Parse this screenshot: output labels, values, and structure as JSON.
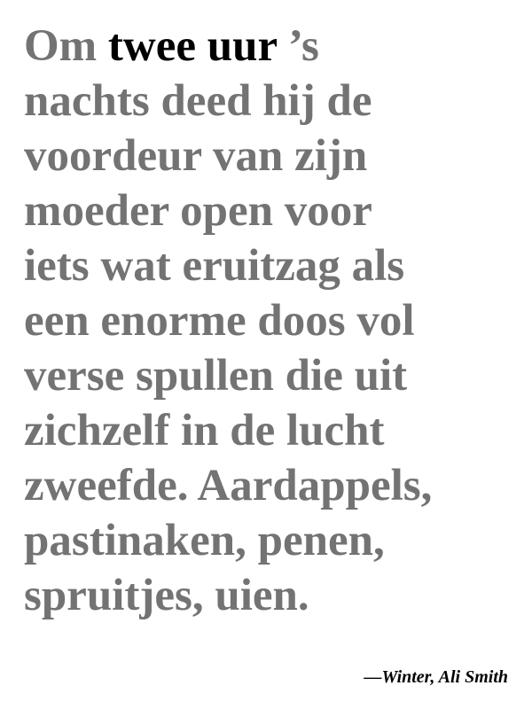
{
  "quote": {
    "first_line": {
      "before": "Om",
      "highlight": "twee uur",
      "after": "’s"
    },
    "lines": [
      "nachts deed hij de",
      "voordeur van zijn",
      "moeder open voor",
      "iets wat eruitzag als",
      "een enorme doos vol",
      "verse spullen die uit",
      "zichzelf in de lucht",
      "zweefde. Aardappels,",
      "pastinaken, penen,",
      "spruitjes, uien."
    ]
  },
  "attribution": "—Winter, Ali Smith",
  "colors": {
    "body_text": "#737373",
    "highlight_text": "#000000",
    "background": "#ffffff"
  }
}
